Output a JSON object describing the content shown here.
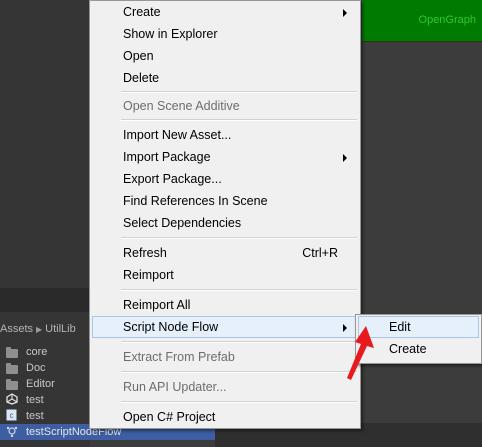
{
  "editor": {
    "green_panel_label": "OpenGraph",
    "breadcrumb": [
      "Assets",
      "UtilLib"
    ],
    "tree": [
      {
        "label": "core",
        "icon": "folder-icon"
      },
      {
        "label": "Doc",
        "icon": "folder-icon"
      },
      {
        "label": "Editor",
        "icon": "folder-icon"
      },
      {
        "label": "test",
        "icon": "unity-scene-icon"
      },
      {
        "label": "test",
        "icon": "csharp-script-icon"
      },
      {
        "label": "testScriptNodeFlow",
        "icon": "node-flow-asset-icon",
        "selected": true
      }
    ]
  },
  "context_menu": {
    "items": [
      {
        "label": "Create",
        "submenu": true
      },
      {
        "label": "Show in Explorer"
      },
      {
        "label": "Open"
      },
      {
        "label": "Delete"
      },
      {
        "label": "Open Scene Additive",
        "disabled": true
      },
      {
        "label": "Import New Asset..."
      },
      {
        "label": "Import Package",
        "submenu": true
      },
      {
        "label": "Export Package..."
      },
      {
        "label": "Find References In Scene"
      },
      {
        "label": "Select Dependencies"
      },
      {
        "label": "Refresh",
        "shortcut": "Ctrl+R"
      },
      {
        "label": "Reimport"
      },
      {
        "label": "Reimport All"
      },
      {
        "label": "Script Node Flow",
        "submenu": true,
        "hover": true
      },
      {
        "label": "Extract From Prefab",
        "disabled": true
      },
      {
        "label": "Run API Updater...",
        "disabled": true
      },
      {
        "label": "Open C# Project"
      }
    ]
  },
  "submenu": {
    "items": [
      {
        "label": "Edit",
        "hover": true
      },
      {
        "label": "Create"
      }
    ]
  },
  "colors": {
    "accent_green": "#007a00",
    "selection": "#3d5ea3",
    "annotation_red": "#e8191f"
  }
}
